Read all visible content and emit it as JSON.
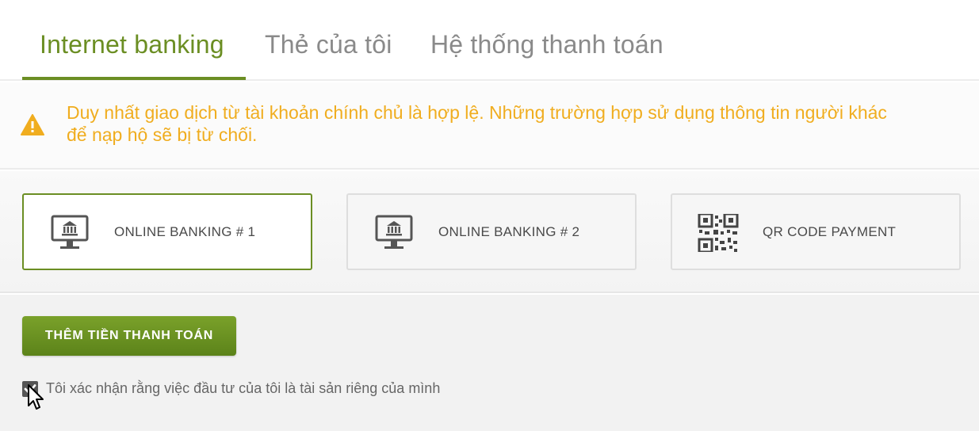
{
  "tabs": [
    {
      "label": "Internet banking",
      "active": true
    },
    {
      "label": "Thẻ của tôi",
      "active": false
    },
    {
      "label": "Hệ thống thanh toán",
      "active": false
    }
  ],
  "alert": {
    "icon": "warning-icon",
    "text_line1": "Duy nhất giao dịch từ tài khoản chính chủ là hợp lệ. Những trường hợp sử dụng thông tin người khác",
    "text_line2": "để nạp hộ sẽ bị từ chối.",
    "color": "#f0ad1f"
  },
  "payment_methods": [
    {
      "label": "ONLINE BANKING # 1",
      "icon": "bank-monitor-icon",
      "selected": true
    },
    {
      "label": "ONLINE BANKING # 2",
      "icon": "bank-monitor-icon",
      "selected": false
    },
    {
      "label": "QR CODE PAYMENT",
      "icon": "qr-code-icon",
      "selected": false
    }
  ],
  "actions": {
    "add_funds_label": "THÊM TIỀN THANH TOÁN"
  },
  "confirmation": {
    "label": "Tôi xác nhận rằng việc đầu tư của tôi là tài sản riêng của mình",
    "checked": true
  },
  "colors": {
    "accent": "#6b8e23",
    "warning": "#f0ad1f"
  }
}
